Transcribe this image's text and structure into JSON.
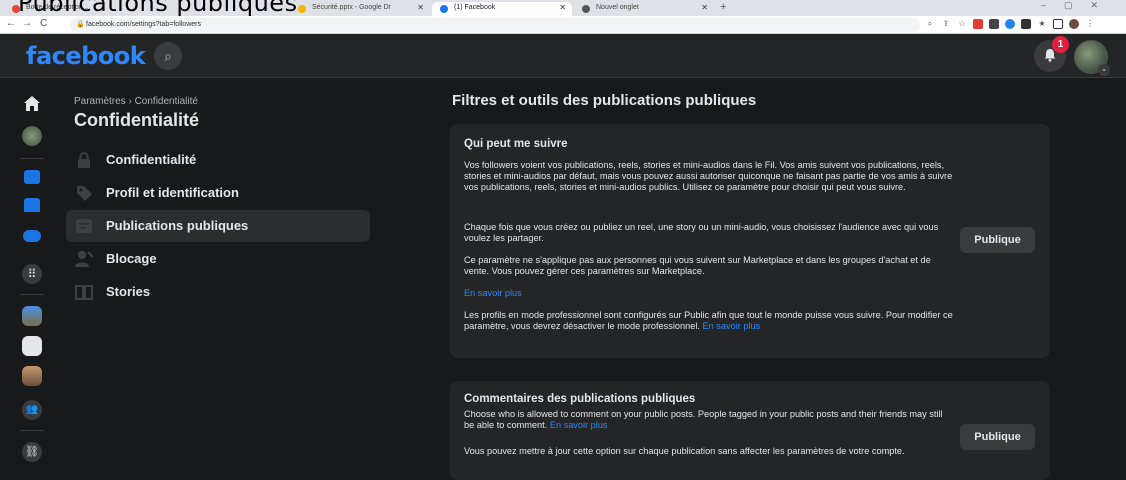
{
  "overlay_title": "Publications publiques",
  "browser": {
    "tabs": [
      {
        "label": "Boîte de réception...",
        "color": "#ea4335"
      },
      {
        "label": "Sécurité.pptx - Google Dr",
        "color": "#f4b400"
      },
      {
        "label": "(1) Facebook",
        "color": "#1877f2"
      },
      {
        "label": "Nouvel onglet",
        "color": "#555555"
      }
    ],
    "url": "facebook.com/settings?tab=followers"
  },
  "header": {
    "logo": "facebook",
    "notification_count": "1"
  },
  "sidebar": {
    "breadcrumb": "Paramètres › Confidentialité",
    "title": "Confidentialité",
    "items": [
      {
        "label": "Confidentialité",
        "icon": "lock-icon",
        "active": false
      },
      {
        "label": "Profil et identification",
        "icon": "tag-icon",
        "active": false
      },
      {
        "label": "Publications publiques",
        "icon": "globe-post-icon",
        "active": true
      },
      {
        "label": "Blocage",
        "icon": "person-block-icon",
        "active": false
      },
      {
        "label": "Stories",
        "icon": "book-icon",
        "active": false
      }
    ]
  },
  "main": {
    "title": "Filtres et outils des publications publiques",
    "sections": [
      {
        "title": "Qui peut me suivre",
        "p1": "Vos followers voient vos publications, reels, stories et mini-audios dans le Fil. Vos amis suivent vos publications, reels, stories et mini-audios par défaut, mais vous pouvez aussi autoriser quiconque ne faisant pas partie de vos amis à suivre vos publications, reels, stories et mini-audios publics. Utilisez ce paramètre pour choisir qui peut vous suivre.",
        "p2": "Chaque fois que vous créez ou publiez un reel, une story ou un mini-audio, vous choisissez l'audience avec qui vous voulez les partager.",
        "p3": "Ce paramètre ne s'applique pas aux personnes qui vous suivent sur Marketplace et dans les groupes d'achat et de vente. Vous pouvez gérer ces paramètres sur Marketplace.",
        "learn_more": "En savoir plus",
        "p4": "Les profils en mode professionnel sont configurés sur Public afin que tout le monde puisse vous suivre. Pour modifier ce paramètre, vous devrez désactiver le mode professionnel.",
        "p4_link": "En savoir plus",
        "button": "Publique"
      },
      {
        "title": "Commentaires des publications publiques",
        "p1": "Choose who is allowed to comment on your public posts. People tagged in your public posts and their friends may still be able to comment.",
        "p1_link": "En savoir plus",
        "p2": "Vous pouvez mettre à jour cette option sur chaque publication sans affecter les paramètres de votre compte.",
        "button": "Publique"
      }
    ]
  }
}
